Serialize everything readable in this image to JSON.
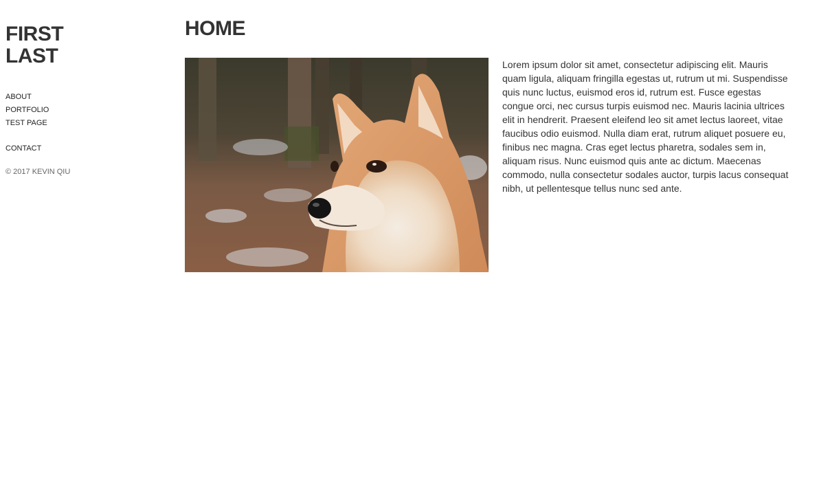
{
  "sidebar": {
    "name_first": "FIRST",
    "name_last": "LAST",
    "nav": {
      "about": "ABOUT",
      "portfolio": "PORTFOLIO",
      "test_page": "TEST PAGE",
      "contact": "CONTACT"
    },
    "copyright": "© 2017 KEVIN QIU"
  },
  "main": {
    "title": "HOME",
    "image_subject": "shiba-inu-dog-photo",
    "paragraph": "Lorem ipsum dolor sit amet, consectetur adipiscing elit. Mauris quam ligula, aliquam fringilla egestas ut, rutrum ut mi. Suspendisse quis nunc luctus, euismod eros id, rutrum est. Fusce egestas congue orci, nec cursus turpis euismod nec. Mauris lacinia ultrices elit in hendrerit. Praesent eleifend leo sit amet lectus laoreet, vitae faucibus odio euismod. Nulla diam erat, rutrum aliquet posuere eu, finibus nec magna. Cras eget lectus pharetra, sodales sem in, aliquam risus. Nunc euismod quis ante ac dictum. Maecenas commodo, nulla consectetur sodales auctor, turpis lacus consequat nibh, ut pellentesque tellus nunc sed ante."
  },
  "colors": {
    "text": "#333333",
    "muted": "#666666",
    "background": "#ffffff"
  }
}
